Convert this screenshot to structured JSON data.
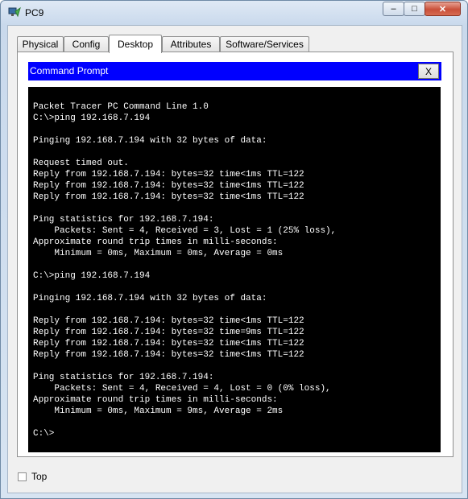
{
  "window": {
    "title": "PC9",
    "minimize_glyph": "–",
    "maximize_glyph": "□",
    "close_glyph": "✕"
  },
  "tabs": [
    {
      "label": "Physical"
    },
    {
      "label": "Config"
    },
    {
      "label": "Desktop",
      "active": true
    },
    {
      "label": "Attributes"
    },
    {
      "label": "Software/Services"
    }
  ],
  "command_prompt": {
    "title": "Command Prompt",
    "close_label": "X",
    "lines": [
      "Packet Tracer PC Command Line 1.0",
      "C:\\>ping 192.168.7.194",
      "",
      "Pinging 192.168.7.194 with 32 bytes of data:",
      "",
      "Request timed out.",
      "Reply from 192.168.7.194: bytes=32 time<1ms TTL=122",
      "Reply from 192.168.7.194: bytes=32 time<1ms TTL=122",
      "Reply from 192.168.7.194: bytes=32 time<1ms TTL=122",
      "",
      "Ping statistics for 192.168.7.194:",
      "    Packets: Sent = 4, Received = 3, Lost = 1 (25% loss),",
      "Approximate round trip times in milli-seconds:",
      "    Minimum = 0ms, Maximum = 0ms, Average = 0ms",
      "",
      "C:\\>ping 192.168.7.194",
      "",
      "Pinging 192.168.7.194 with 32 bytes of data:",
      "",
      "Reply from 192.168.7.194: bytes=32 time<1ms TTL=122",
      "Reply from 192.168.7.194: bytes=32 time=9ms TTL=122",
      "Reply from 192.168.7.194: bytes=32 time<1ms TTL=122",
      "Reply from 192.168.7.194: bytes=32 time<1ms TTL=122",
      "",
      "Ping statistics for 192.168.7.194:",
      "    Packets: Sent = 4, Received = 4, Lost = 0 (0% loss),",
      "Approximate round trip times in milli-seconds:",
      "    Minimum = 0ms, Maximum = 9ms, Average = 2ms",
      "",
      "C:\\>"
    ]
  },
  "footer": {
    "top_label": "Top",
    "top_checked": false
  },
  "colors": {
    "prompt_header": "#0000ff",
    "terminal_background": "#000000",
    "terminal_text": "#ffffff"
  }
}
